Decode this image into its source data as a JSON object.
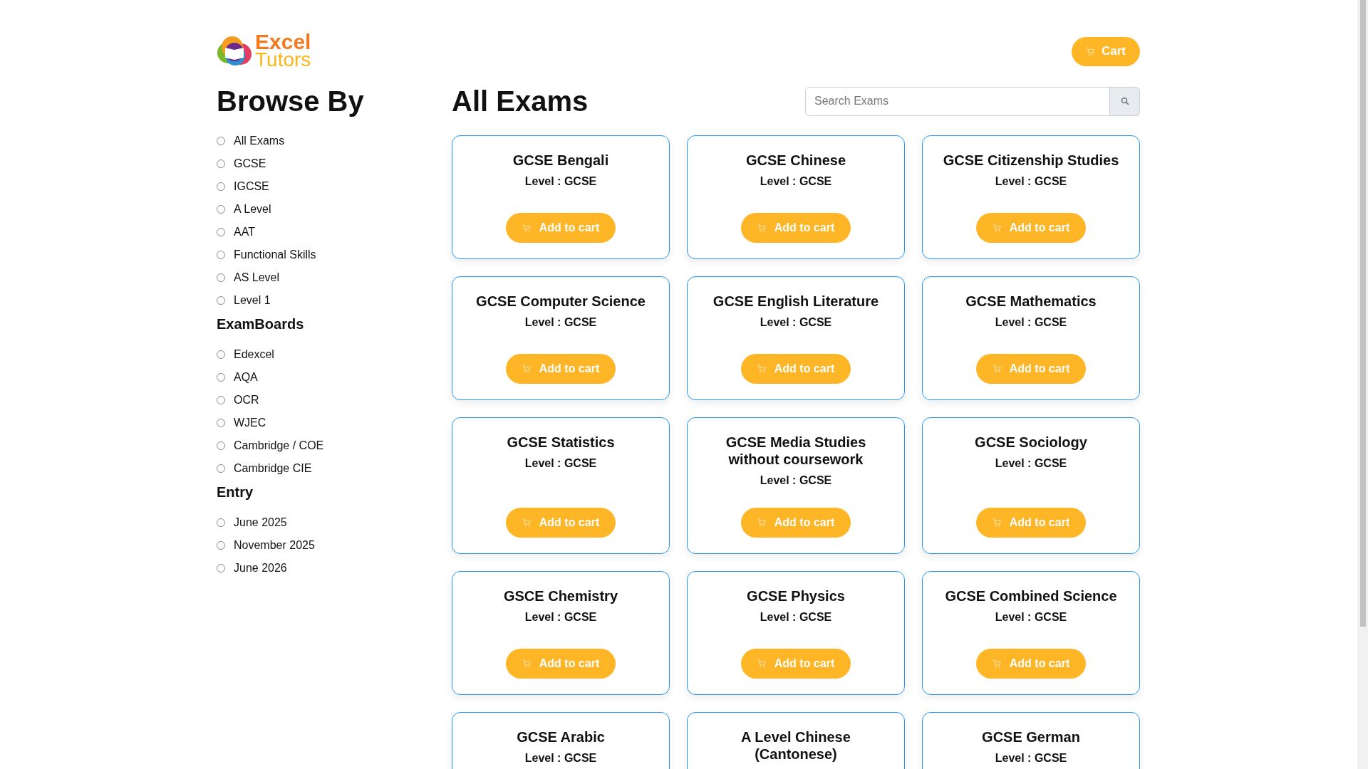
{
  "logo": {
    "line_1": "Excel",
    "line_2": "Tutors"
  },
  "cart_button": {
    "label": "Cart"
  },
  "sidebar": {
    "title": "Browse By",
    "groups": [
      {
        "options": [
          {
            "label": "All Exams",
            "selected": false
          },
          {
            "label": "GCSE",
            "selected": false
          },
          {
            "label": "IGCSE",
            "selected": false
          },
          {
            "label": "A Level",
            "selected": false
          },
          {
            "label": "AAT",
            "selected": false
          },
          {
            "label": "Functional Skills",
            "selected": false
          },
          {
            "label": "AS Level",
            "selected": false
          },
          {
            "label": "Level 1",
            "selected": false
          }
        ]
      },
      {
        "heading": "ExamBoards",
        "options": [
          {
            "label": "Edexcel",
            "selected": false
          },
          {
            "label": "AQA",
            "selected": false
          },
          {
            "label": "OCR",
            "selected": false
          },
          {
            "label": "WJEC",
            "selected": false
          },
          {
            "label": "Cambridge / COE",
            "selected": false
          },
          {
            "label": "Cambridge CIE",
            "selected": false
          }
        ]
      },
      {
        "heading": "Entry",
        "options": [
          {
            "label": "June 2025",
            "selected": false
          },
          {
            "label": "November 2025",
            "selected": false
          },
          {
            "label": "June 2026",
            "selected": false
          }
        ]
      }
    ]
  },
  "main": {
    "title": "All Exams",
    "search": {
      "placeholder": "Search Exams"
    },
    "exams": [
      {
        "title": "GCSE Bengali",
        "level": "Level : GCSE",
        "button": "Add to cart"
      },
      {
        "title": "GCSE Chinese",
        "level": "Level : GCSE",
        "button": "Add to cart"
      },
      {
        "title": "GCSE Citizenship Studies",
        "level": "Level : GCSE",
        "button": "Add to cart"
      },
      {
        "title": "GCSE Computer Science",
        "level": "Level : GCSE",
        "button": "Add to cart"
      },
      {
        "title": "GCSE English Literature",
        "level": "Level : GCSE",
        "button": "Add to cart"
      },
      {
        "title": "GCSE Mathematics",
        "level": "Level : GCSE",
        "button": "Add to cart"
      },
      {
        "title": "GCSE Statistics",
        "level": "Level : GCSE",
        "button": "Add to cart"
      },
      {
        "title": "GCSE Media Studies without coursework",
        "level": "Level : GCSE",
        "button": "Add to cart"
      },
      {
        "title": "GCSE Sociology",
        "level": "Level : GCSE",
        "button": "Add to cart"
      },
      {
        "title": "GSCE Chemistry",
        "level": "Level : GCSE",
        "button": "Add to cart"
      },
      {
        "title": "GCSE Physics",
        "level": "Level : GCSE",
        "button": "Add to cart"
      },
      {
        "title": "GCSE Combined Science",
        "level": "Level : GCSE",
        "button": "Add to cart"
      },
      {
        "title": "GCSE Arabic",
        "level": "Level : GCSE"
      },
      {
        "title": "A Level Chinese (Cantonese)"
      },
      {
        "title": "GCSE German",
        "level": "Level : GCSE"
      }
    ]
  }
}
